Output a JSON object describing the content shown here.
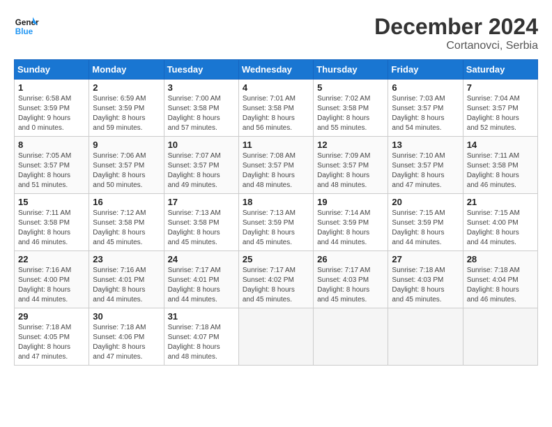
{
  "header": {
    "logo_line1": "General",
    "logo_line2": "Blue",
    "month_title": "December 2024",
    "location": "Cortanovci, Serbia"
  },
  "columns": [
    "Sunday",
    "Monday",
    "Tuesday",
    "Wednesday",
    "Thursday",
    "Friday",
    "Saturday"
  ],
  "weeks": [
    [
      {
        "day": "1",
        "info": "Sunrise: 6:58 AM\nSunset: 3:59 PM\nDaylight: 9 hours\nand 0 minutes."
      },
      {
        "day": "2",
        "info": "Sunrise: 6:59 AM\nSunset: 3:59 PM\nDaylight: 8 hours\nand 59 minutes."
      },
      {
        "day": "3",
        "info": "Sunrise: 7:00 AM\nSunset: 3:58 PM\nDaylight: 8 hours\nand 57 minutes."
      },
      {
        "day": "4",
        "info": "Sunrise: 7:01 AM\nSunset: 3:58 PM\nDaylight: 8 hours\nand 56 minutes."
      },
      {
        "day": "5",
        "info": "Sunrise: 7:02 AM\nSunset: 3:58 PM\nDaylight: 8 hours\nand 55 minutes."
      },
      {
        "day": "6",
        "info": "Sunrise: 7:03 AM\nSunset: 3:57 PM\nDaylight: 8 hours\nand 54 minutes."
      },
      {
        "day": "7",
        "info": "Sunrise: 7:04 AM\nSunset: 3:57 PM\nDaylight: 8 hours\nand 52 minutes."
      }
    ],
    [
      {
        "day": "8",
        "info": "Sunrise: 7:05 AM\nSunset: 3:57 PM\nDaylight: 8 hours\nand 51 minutes."
      },
      {
        "day": "9",
        "info": "Sunrise: 7:06 AM\nSunset: 3:57 PM\nDaylight: 8 hours\nand 50 minutes."
      },
      {
        "day": "10",
        "info": "Sunrise: 7:07 AM\nSunset: 3:57 PM\nDaylight: 8 hours\nand 49 minutes."
      },
      {
        "day": "11",
        "info": "Sunrise: 7:08 AM\nSunset: 3:57 PM\nDaylight: 8 hours\nand 48 minutes."
      },
      {
        "day": "12",
        "info": "Sunrise: 7:09 AM\nSunset: 3:57 PM\nDaylight: 8 hours\nand 48 minutes."
      },
      {
        "day": "13",
        "info": "Sunrise: 7:10 AM\nSunset: 3:57 PM\nDaylight: 8 hours\nand 47 minutes."
      },
      {
        "day": "14",
        "info": "Sunrise: 7:11 AM\nSunset: 3:58 PM\nDaylight: 8 hours\nand 46 minutes."
      }
    ],
    [
      {
        "day": "15",
        "info": "Sunrise: 7:11 AM\nSunset: 3:58 PM\nDaylight: 8 hours\nand 46 minutes."
      },
      {
        "day": "16",
        "info": "Sunrise: 7:12 AM\nSunset: 3:58 PM\nDaylight: 8 hours\nand 45 minutes."
      },
      {
        "day": "17",
        "info": "Sunrise: 7:13 AM\nSunset: 3:58 PM\nDaylight: 8 hours\nand 45 minutes."
      },
      {
        "day": "18",
        "info": "Sunrise: 7:13 AM\nSunset: 3:59 PM\nDaylight: 8 hours\nand 45 minutes."
      },
      {
        "day": "19",
        "info": "Sunrise: 7:14 AM\nSunset: 3:59 PM\nDaylight: 8 hours\nand 44 minutes."
      },
      {
        "day": "20",
        "info": "Sunrise: 7:15 AM\nSunset: 3:59 PM\nDaylight: 8 hours\nand 44 minutes."
      },
      {
        "day": "21",
        "info": "Sunrise: 7:15 AM\nSunset: 4:00 PM\nDaylight: 8 hours\nand 44 minutes."
      }
    ],
    [
      {
        "day": "22",
        "info": "Sunrise: 7:16 AM\nSunset: 4:00 PM\nDaylight: 8 hours\nand 44 minutes."
      },
      {
        "day": "23",
        "info": "Sunrise: 7:16 AM\nSunset: 4:01 PM\nDaylight: 8 hours\nand 44 minutes."
      },
      {
        "day": "24",
        "info": "Sunrise: 7:17 AM\nSunset: 4:01 PM\nDaylight: 8 hours\nand 44 minutes."
      },
      {
        "day": "25",
        "info": "Sunrise: 7:17 AM\nSunset: 4:02 PM\nDaylight: 8 hours\nand 45 minutes."
      },
      {
        "day": "26",
        "info": "Sunrise: 7:17 AM\nSunset: 4:03 PM\nDaylight: 8 hours\nand 45 minutes."
      },
      {
        "day": "27",
        "info": "Sunrise: 7:18 AM\nSunset: 4:03 PM\nDaylight: 8 hours\nand 45 minutes."
      },
      {
        "day": "28",
        "info": "Sunrise: 7:18 AM\nSunset: 4:04 PM\nDaylight: 8 hours\nand 46 minutes."
      }
    ],
    [
      {
        "day": "29",
        "info": "Sunrise: 7:18 AM\nSunset: 4:05 PM\nDaylight: 8 hours\nand 47 minutes."
      },
      {
        "day": "30",
        "info": "Sunrise: 7:18 AM\nSunset: 4:06 PM\nDaylight: 8 hours\nand 47 minutes."
      },
      {
        "day": "31",
        "info": "Sunrise: 7:18 AM\nSunset: 4:07 PM\nDaylight: 8 hours\nand 48 minutes."
      },
      {
        "day": "",
        "info": ""
      },
      {
        "day": "",
        "info": ""
      },
      {
        "day": "",
        "info": ""
      },
      {
        "day": "",
        "info": ""
      }
    ]
  ]
}
